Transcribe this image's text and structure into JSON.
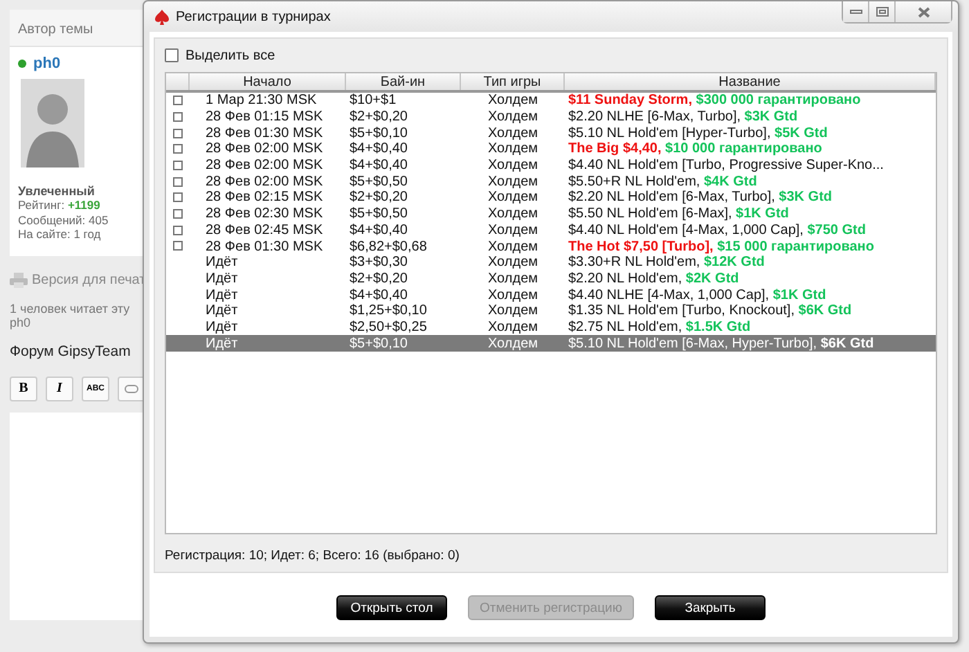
{
  "forum": {
    "author_card": {
      "header": "Автор темы",
      "username": "ph0",
      "rank": "Увлеченный",
      "rating_label": "Рейтинг: ",
      "rating_value": "+1199",
      "posts": "Сообщений: 405",
      "on_site": "На сайте: 1 год"
    },
    "print_link": "Версия для печат",
    "readers": "1 человек читает эту",
    "reader_name": "ph0",
    "forum_title": "Форум GipsyTeam",
    "editor_buttons": [
      "B",
      "I",
      "ABC"
    ]
  },
  "dialog": {
    "title": "Регистрации в турнирах",
    "select_all": {
      "label": "Выделить все",
      "checked": false
    },
    "table": {
      "columns": [
        "Начало",
        "Бай-ин",
        "Тип игры",
        "Название"
      ],
      "rows": [
        {
          "checkbox": {
            "checked": false
          },
          "start": "1 Мар 21:30 MSK",
          "buy_in": "$10+$1",
          "game": "Холдем",
          "name": [
            {
              "kind": "featured",
              "text": "$11 Sunday Storm, "
            },
            {
              "kind": "guarantee",
              "text": "$300 000 гарантировано"
            }
          ],
          "selected": false
        },
        {
          "checkbox": {
            "checked": false
          },
          "start": "28 Фев 01:15 MSK",
          "buy_in": "$2+$0,20",
          "game": "Холдем",
          "name": [
            {
              "kind": "plain",
              "text": "$2.20 NLHE [6-Max, Turbo], "
            },
            {
              "kind": "guarantee",
              "text": "$3K Gtd"
            }
          ],
          "selected": false
        },
        {
          "checkbox": {
            "checked": false
          },
          "start": "28 Фев 01:30 MSK",
          "buy_in": "$5+$0,10",
          "game": "Холдем",
          "name": [
            {
              "kind": "plain",
              "text": "$5.10 NL Hold'em [Hyper-Turbo], "
            },
            {
              "kind": "guarantee",
              "text": "$5K Gtd"
            }
          ],
          "selected": false
        },
        {
          "checkbox": {
            "checked": false
          },
          "start": "28 Фев 02:00 MSK",
          "buy_in": "$4+$0,40",
          "game": "Холдем",
          "name": [
            {
              "kind": "featured",
              "text": "The Big $4,40, "
            },
            {
              "kind": "guarantee",
              "text": "$10 000 гарантировано"
            }
          ],
          "selected": false
        },
        {
          "checkbox": {
            "checked": false
          },
          "start": "28 Фев 02:00 MSK",
          "buy_in": "$4+$0,40",
          "game": "Холдем",
          "name": [
            {
              "kind": "plain",
              "text": "$4.40 NL Hold'em [Turbo, Progressive Super-Kno..."
            }
          ],
          "selected": false
        },
        {
          "checkbox": {
            "checked": false
          },
          "start": "28 Фев 02:00 MSK",
          "buy_in": "$5+$0,50",
          "game": "Холдем",
          "name": [
            {
              "kind": "plain",
              "text": "$5.50+R NL Hold'em, "
            },
            {
              "kind": "guarantee",
              "text": "$4K Gtd"
            }
          ],
          "selected": false
        },
        {
          "checkbox": {
            "checked": false
          },
          "start": "28 Фев 02:15 MSK",
          "buy_in": "$2+$0,20",
          "game": "Холдем",
          "name": [
            {
              "kind": "plain",
              "text": "$2.20 NL Hold'em [6-Max, Turbo], "
            },
            {
              "kind": "guarantee",
              "text": "$3K Gtd"
            }
          ],
          "selected": false
        },
        {
          "checkbox": {
            "checked": false
          },
          "start": "28 Фев 02:30 MSK",
          "buy_in": "$5+$0,50",
          "game": "Холдем",
          "name": [
            {
              "kind": "plain",
              "text": "$5.50 NL Hold'em [6-Max], "
            },
            {
              "kind": "guarantee",
              "text": "$1K Gtd"
            }
          ],
          "selected": false
        },
        {
          "checkbox": {
            "checked": false
          },
          "start": "28 Фев 02:45 MSK",
          "buy_in": "$4+$0,40",
          "game": "Холдем",
          "name": [
            {
              "kind": "plain",
              "text": "$4.40 NL Hold'em [4-Max, 1,000 Cap], "
            },
            {
              "kind": "guarantee",
              "text": "$750 Gtd"
            }
          ],
          "selected": false
        },
        {
          "checkbox": {
            "checked": false
          },
          "start": "28 Фев 01:30 MSK",
          "buy_in": "$6,82+$0,68",
          "game": "Холдем",
          "name": [
            {
              "kind": "featured",
              "text": "The Hot $7,50 [Turbo], "
            },
            {
              "kind": "guarantee",
              "text": "$15 000 гарантировано"
            }
          ],
          "selected": false
        },
        {
          "start": "Идёт",
          "buy_in": "$3+$0,30",
          "game": "Холдем",
          "name": [
            {
              "kind": "plain",
              "text": "$3.30+R NL Hold'em, "
            },
            {
              "kind": "guarantee",
              "text": "$12K Gtd"
            }
          ],
          "selected": false
        },
        {
          "start": "Идёт",
          "buy_in": "$2+$0,20",
          "game": "Холдем",
          "name": [
            {
              "kind": "plain",
              "text": "$2.20 NL Hold'em, "
            },
            {
              "kind": "guarantee",
              "text": "$2K Gtd"
            }
          ],
          "selected": false
        },
        {
          "start": "Идёт",
          "buy_in": "$4+$0,40",
          "game": "Холдем",
          "name": [
            {
              "kind": "plain",
              "text": "$4.40 NLHE [4-Max, 1,000 Cap], "
            },
            {
              "kind": "guarantee",
              "text": "$1K Gtd"
            }
          ],
          "selected": false
        },
        {
          "start": "Идёт",
          "buy_in": "$1,25+$0,10",
          "game": "Холдем",
          "name": [
            {
              "kind": "plain",
              "text": "$1.35 NL Hold'em [Turbo, Knockout], "
            },
            {
              "kind": "guarantee",
              "text": "$6K Gtd"
            }
          ],
          "selected": false
        },
        {
          "start": "Идёт",
          "buy_in": "$2,50+$0,25",
          "game": "Холдем",
          "name": [
            {
              "kind": "plain",
              "text": "$2.75 NL Hold'em, "
            },
            {
              "kind": "guarantee",
              "text": "$1.5K Gtd"
            }
          ],
          "selected": false
        },
        {
          "start": "Идёт",
          "buy_in": "$5+$0,10",
          "game": "Холдем",
          "name": [
            {
              "kind": "plain",
              "text": "$5.10 NL Hold'em [6-Max, Hyper-Turbo], "
            },
            {
              "kind": "guarantee",
              "text": "$6K Gtd"
            }
          ],
          "selected": true
        }
      ]
    },
    "status": "Регистрация: 10; Идет: 6; Всего: 16 (выбрано: 0)",
    "buttons": [
      {
        "label": "Открыть стол",
        "disabled": false
      },
      {
        "label": "Отменить регистрацию",
        "disabled": true
      },
      {
        "label": "Закрыть",
        "disabled": false
      }
    ]
  }
}
